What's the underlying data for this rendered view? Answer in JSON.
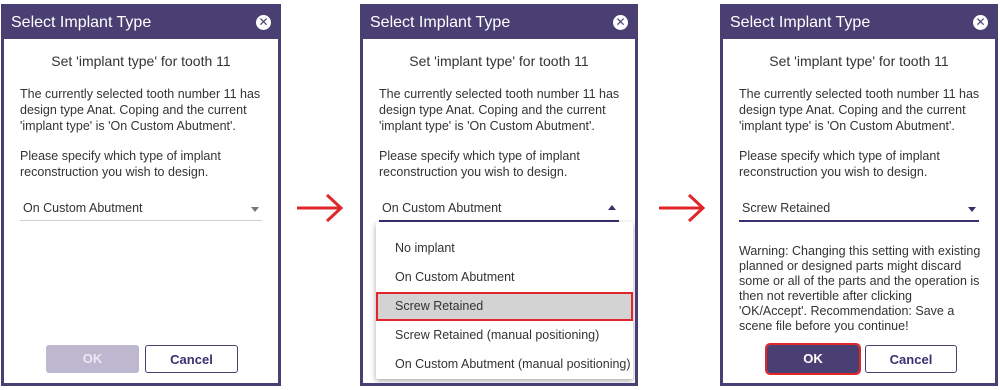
{
  "dialog": {
    "title": "Select Implant Type",
    "close_icon": "close-icon",
    "subtitle": "Set 'implant type' for tooth 11",
    "info_text": "The currently selected tooth number 11 has design type Anat. Coping and the current 'implant type' is 'On Custom Abutment'.",
    "prompt_text": "Please specify which type of implant reconstruction you wish to design.",
    "ok_label": "OK",
    "cancel_label": "Cancel"
  },
  "step1": {
    "selected_value": "On Custom Abutment"
  },
  "step2": {
    "selected_value": "On Custom Abutment",
    "options": [
      "No implant",
      "On Custom Abutment",
      "Screw Retained",
      "Screw Retained (manual positioning)",
      "On Custom Abutment (manual positioning)"
    ],
    "highlighted_option": "Screw Retained"
  },
  "step3": {
    "selected_value": "Screw Retained",
    "warning_text": "Warning: Changing this setting with existing planned or designed parts might discard some or all of the parts and the operation is then not revertible after clicking 'OK/Accept'. Recommendation: Save a scene file before you continue!"
  },
  "colors": {
    "titlebar": "#4a3f73",
    "highlight": "#e0262b",
    "arrow": "#e0262b",
    "ok_disabled": "#bdb7cf"
  }
}
